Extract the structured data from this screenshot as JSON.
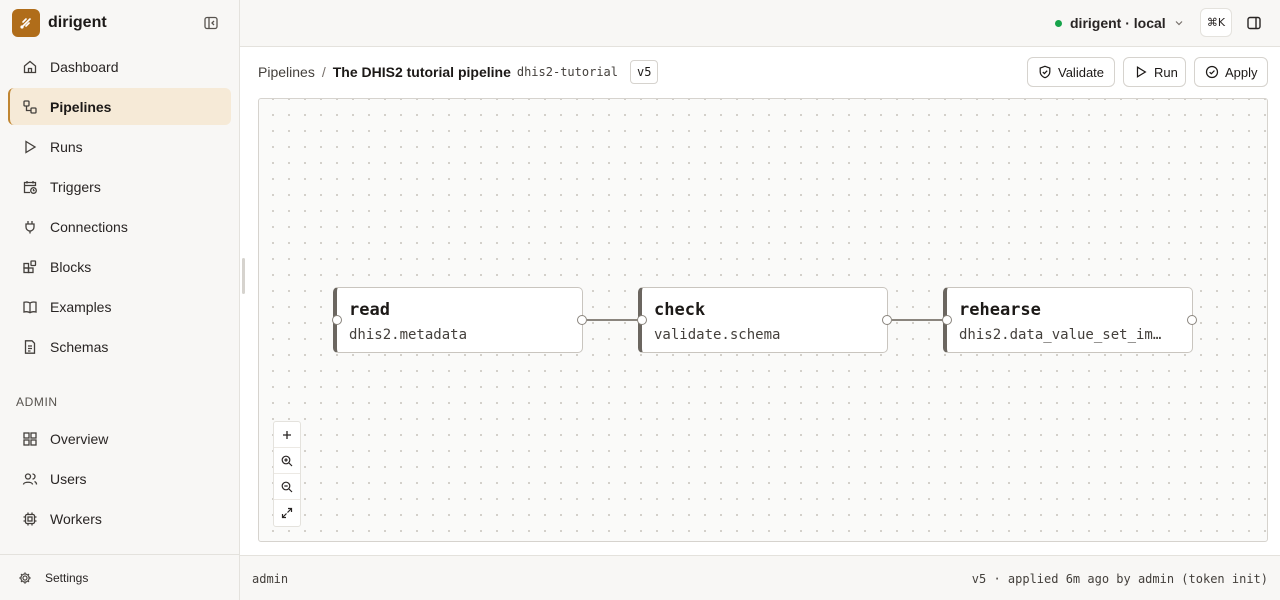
{
  "app": {
    "name": "dirigent"
  },
  "sidebar": {
    "items": [
      {
        "label": "Dashboard",
        "icon": "home-icon"
      },
      {
        "label": "Pipelines",
        "icon": "pipeline-icon",
        "active": true
      },
      {
        "label": "Runs",
        "icon": "play-icon"
      },
      {
        "label": "Triggers",
        "icon": "calendar-clock-icon"
      },
      {
        "label": "Connections",
        "icon": "plug-icon"
      },
      {
        "label": "Blocks",
        "icon": "blocks-icon"
      },
      {
        "label": "Examples",
        "icon": "book-icon"
      },
      {
        "label": "Schemas",
        "icon": "file-icon"
      }
    ],
    "admin_label": "ADMIN",
    "admin_items": [
      {
        "label": "Overview",
        "icon": "grid-icon"
      },
      {
        "label": "Users",
        "icon": "users-icon"
      },
      {
        "label": "Workers",
        "icon": "cpu-icon"
      }
    ],
    "settings_label": "Settings"
  },
  "topbar": {
    "env_label": "dirigent · local",
    "env_status_color": "#16a34a",
    "shortcut": "⌘K"
  },
  "header": {
    "breadcrumb_root": "Pipelines",
    "breadcrumb_sep": "/",
    "pipeline_title": "The DHIS2 tutorial pipeline",
    "pipeline_slug": "dhis2-tutorial",
    "version": "v5",
    "actions": {
      "validate": "Validate",
      "run": "Run",
      "apply": "Apply"
    }
  },
  "graph": {
    "nodes": [
      {
        "name": "read",
        "kind": "dhis2.metadata"
      },
      {
        "name": "check",
        "kind": "validate.schema"
      },
      {
        "name": "rehearse",
        "kind": "dhis2.data_value_set_im…"
      }
    ],
    "controls": [
      "add-icon",
      "zoom-in-icon",
      "zoom-out-icon",
      "fit-view-icon"
    ]
  },
  "status": {
    "user": "admin",
    "summary": "v5 · applied 6m ago by admin (token init)"
  },
  "colors": {
    "accent": "#b06d1a",
    "active_bg": "#f6ead7"
  }
}
